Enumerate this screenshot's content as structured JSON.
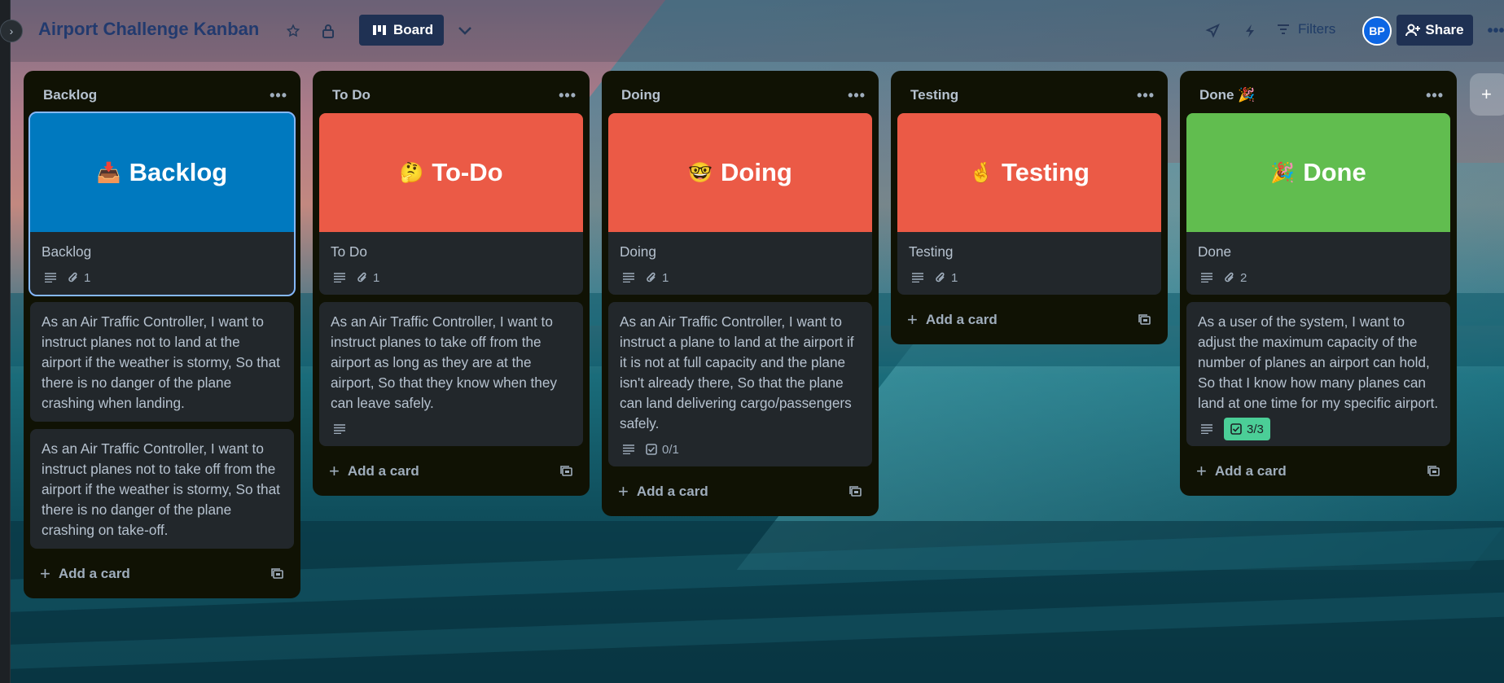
{
  "header": {
    "title": "Airport Challenge Kanban",
    "view_label": "Board",
    "filters_label": "Filters",
    "avatar_initials": "BP",
    "share_label": "Share"
  },
  "lists": [
    {
      "title": "Backlog",
      "cover_emoji": "📥",
      "cover_text": "Backlog",
      "cover_color": "#0079bf",
      "cards": [
        {
          "title": "Backlog",
          "attachments": "1"
        },
        {
          "title": "As an Air Traffic Controller, I want to instruct planes not to land at the airport if the weather is stormy, So that there is no danger of the plane crashing when landing."
        },
        {
          "title": "As an Air Traffic Controller, I want to instruct planes not to take off from the airport if the weather is stormy, So that there is no danger of the plane crashing on take-off."
        }
      ],
      "add_label": "Add a card"
    },
    {
      "title": "To Do",
      "cover_emoji": "🤔",
      "cover_text": "To-Do",
      "cover_color": "#eb5a46",
      "cards": [
        {
          "title": "To Do",
          "attachments": "1"
        },
        {
          "title": "As an Air Traffic Controller, I want to instruct planes to take off from the airport as long as they are at the airport, So that they know when they can leave safely."
        }
      ],
      "add_label": "Add a card"
    },
    {
      "title": "Doing",
      "cover_emoji": "🤓",
      "cover_text": "Doing",
      "cover_color": "#eb5a46",
      "cards": [
        {
          "title": "Doing",
          "attachments": "1"
        },
        {
          "title": "As an Air Traffic Controller, I want to instruct a plane to land at the airport if it is not at full capacity and the plane isn't already there, So that the plane can land delivering cargo/passengers safely.",
          "checklist": "0/1"
        }
      ],
      "add_label": "Add a card"
    },
    {
      "title": "Testing",
      "cover_emoji": "🤞",
      "cover_text": "Testing",
      "cover_color": "#eb5a46",
      "cards": [
        {
          "title": "Testing",
          "attachments": "1"
        }
      ],
      "add_label": "Add a card"
    },
    {
      "title": "Done 🎉",
      "cover_emoji": "🎉",
      "cover_text": "Done",
      "cover_color": "#61bd4f",
      "cards": [
        {
          "title": "Done",
          "attachments": "2"
        },
        {
          "title": "As a user of the system, I want to adjust the maximum capacity of the number of planes an airport can hold, So that I know how many planes can land at one time for my specific airport.",
          "checklist": "3/3"
        }
      ],
      "add_label": "Add a card"
    }
  ]
}
